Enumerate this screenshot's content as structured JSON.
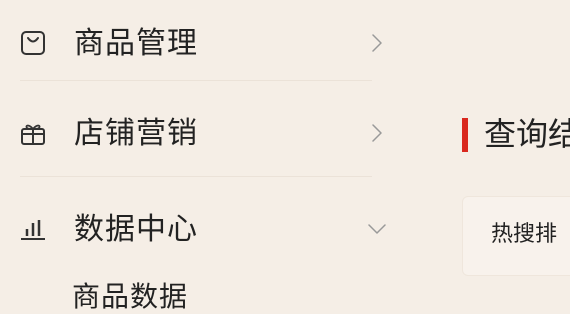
{
  "sidebar": {
    "items": [
      {
        "label": "商品管理",
        "icon": "shopping-bag-icon",
        "chevron": "chevron-right-icon"
      },
      {
        "label": "店铺营销",
        "icon": "gift-icon",
        "chevron": "chevron-right-icon"
      },
      {
        "label": "数据中心",
        "icon": "bar-chart-icon",
        "chevron": "chevron-down-icon"
      }
    ],
    "submenu": {
      "items": [
        {
          "label": "商品数据"
        }
      ]
    }
  },
  "main": {
    "section_title": "查询结",
    "card_label": "热搜排",
    "accent_color": "#d9281e"
  }
}
